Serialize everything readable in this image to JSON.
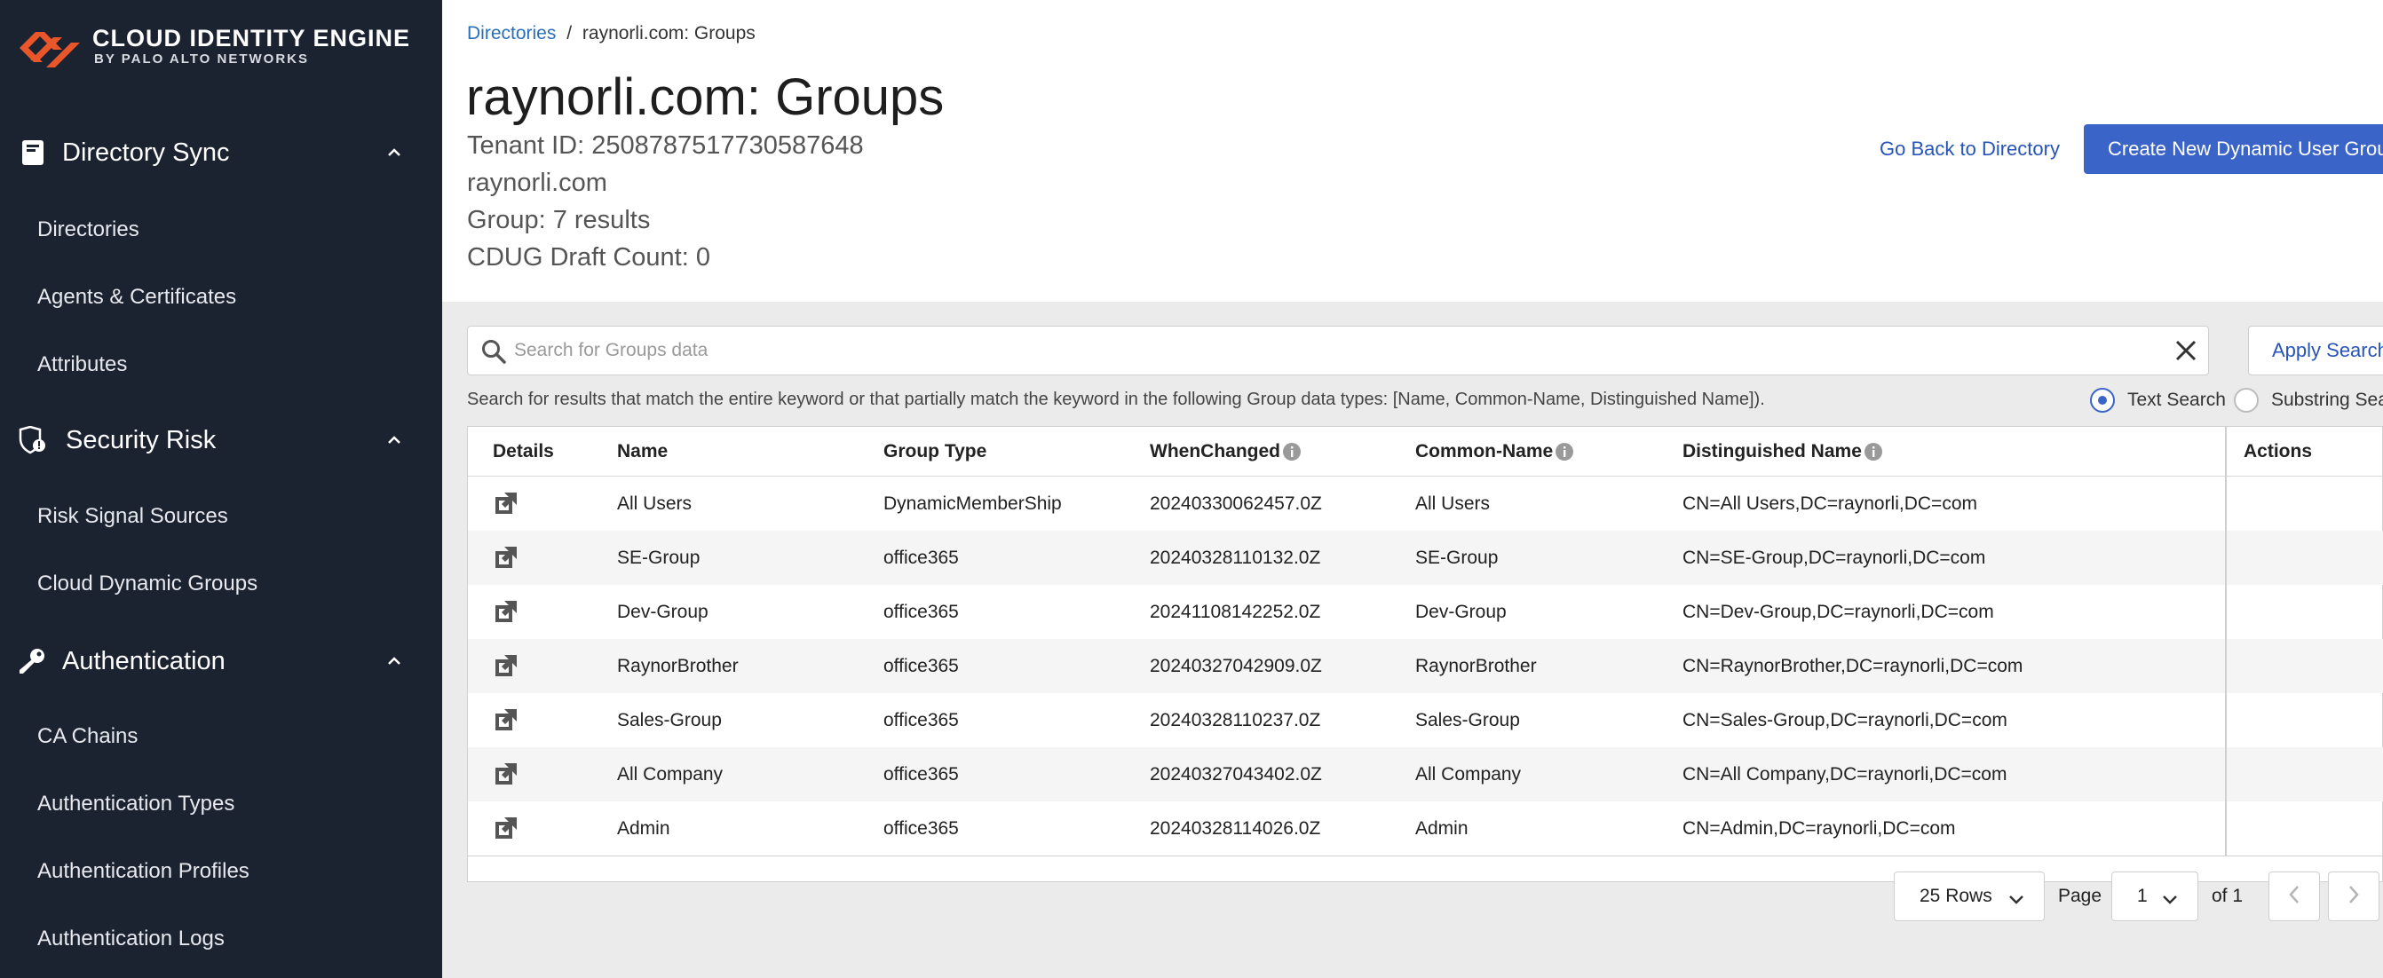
{
  "brand": {
    "name": "CLOUD IDENTITY ENGINE",
    "sub": "BY PALO ALTO NETWORKS",
    "accent": "#e8562a"
  },
  "sidebar": {
    "sections": [
      {
        "label": "Directory Sync",
        "icon": "book-icon",
        "items": [
          "Directories",
          "Agents & Certificates",
          "Attributes"
        ]
      },
      {
        "label": "Security Risk",
        "icon": "shield-risk-icon",
        "items": [
          "Risk Signal Sources",
          "Cloud Dynamic Groups"
        ]
      },
      {
        "label": "Authentication",
        "icon": "key-icon",
        "items": [
          "CA Chains",
          "Authentication Types",
          "Authentication Profiles",
          "Authentication Logs"
        ]
      }
    ]
  },
  "header": {
    "breadcrumb": {
      "link": "Directories",
      "separator": "/",
      "current": "raynorli.com: Groups"
    },
    "title": "raynorli.com: Groups",
    "tenant": "Tenant ID: 2508787517730587648",
    "domain": "raynorli.com",
    "group_count": "Group: 7 results",
    "cdug_count": "CDUG Draft Count: 0",
    "go_back": "Go Back to Directory",
    "create": "Create New Dynamic User Group"
  },
  "search": {
    "placeholder": "Search for Groups data",
    "apply": "Apply Search",
    "help": "Search for results that match the entire keyword or that partially match the keyword in the following Group data types: [Name, Common-Name, Distinguished Name]).",
    "options": [
      {
        "label": "Text Search",
        "selected": true
      },
      {
        "label": "Substring Search",
        "selected": false
      }
    ]
  },
  "table": {
    "columns": {
      "details": "Details",
      "name": "Name",
      "group_type": "Group Type",
      "when_changed": "WhenChanged",
      "common_name": "Common-Name",
      "distinguished_name": "Distinguished Name",
      "actions": "Actions"
    },
    "rows": [
      {
        "name": "All Users",
        "type": "DynamicMemberShip",
        "changed": "20240330062457.0Z",
        "cn": "All Users",
        "dn": "CN=All Users,DC=raynorli,DC=com"
      },
      {
        "name": "SE-Group",
        "type": "office365",
        "changed": "20240328110132.0Z",
        "cn": "SE-Group",
        "dn": "CN=SE-Group,DC=raynorli,DC=com"
      },
      {
        "name": "Dev-Group",
        "type": "office365",
        "changed": "20241108142252.0Z",
        "cn": "Dev-Group",
        "dn": "CN=Dev-Group,DC=raynorli,DC=com"
      },
      {
        "name": "RaynorBrother",
        "type": "office365",
        "changed": "20240327042909.0Z",
        "cn": "RaynorBrother",
        "dn": "CN=RaynorBrother,DC=raynorli,DC=com"
      },
      {
        "name": "Sales-Group",
        "type": "office365",
        "changed": "20240328110237.0Z",
        "cn": "Sales-Group",
        "dn": "CN=Sales-Group,DC=raynorli,DC=com"
      },
      {
        "name": "All Company",
        "type": "office365",
        "changed": "20240327043402.0Z",
        "cn": "All Company",
        "dn": "CN=All Company,DC=raynorli,DC=com"
      },
      {
        "name": "Admin",
        "type": "office365",
        "changed": "20240328114026.0Z",
        "cn": "Admin",
        "dn": "CN=Admin,DC=raynorli,DC=com"
      }
    ]
  },
  "pagination": {
    "rows": "25 Rows",
    "page_label": "Page",
    "page": "1",
    "of": "of 1"
  }
}
